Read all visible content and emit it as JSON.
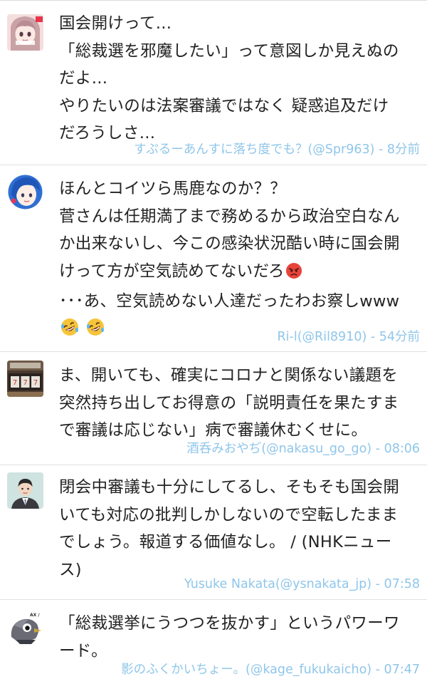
{
  "tweets": [
    {
      "lines": [
        "国会開けって…",
        "「総裁選を邪魔したい」って意図しか見えぬの",
        "だよ…",
        "やりたいのは法案審議ではなく 疑惑追及だけ",
        "だろうしさ…"
      ],
      "meta": "すぷるーあんすに落ち度でも？(@Spr963) - 8分前",
      "avatar": "anime-girl-avatar"
    },
    {
      "lines": [
        "ほんとコイツら馬鹿なのか？？",
        "菅さんは任期満了まで務めるから政治空白なん",
        "か出来ないし、今この感染状況酷い時に国会開",
        "けって方が空気読めてないだろ",
        "･･･あ、空気読めない人達だったわお察しwww",
        ""
      ],
      "line4_emoji": "angry-face-emoji",
      "line6_emojis": [
        "rolling-on-floor-laughing-emoji",
        "rolling-on-floor-laughing-emoji"
      ],
      "meta": "Ri-l(@Ril8910) - 54分前",
      "avatar": "blue-hair-avatar"
    },
    {
      "lines": [
        "ま、開いても、確実にコロナと関係ない議題を",
        "突然持ち出してお得意の「説明責任を果たすま",
        "で審議は応じない」病で審議休むくせに。"
      ],
      "meta": "酒呑みおやぢ(@nakasu_go_go) - 08:06",
      "avatar": "slot-machine-avatar"
    },
    {
      "lines": [
        "閉会中審議も十分にしてるし、そもそも国会開",
        "いても対応の批判しかしないので空転したまま",
        "でしょう。報道する価値なし。 / (NHKニュー",
        "ス)"
      ],
      "meta": "Yusuke Nakata(@ysnakata_jp) - 07:58",
      "avatar": "man-in-suit-avatar"
    },
    {
      "lines": [
        "「総裁選挙にうつつを抜かす」というパワーワ",
        "ード。"
      ],
      "meta": "影のふくかいちょー。(@kage_fukukaicho) - 07:47",
      "avatar": "pigeon-avatar"
    }
  ],
  "colors": {
    "meta_text": "#8fc6ea",
    "body_text": "#222222",
    "divider": "#e1e1e1",
    "background": "#ffffff"
  }
}
